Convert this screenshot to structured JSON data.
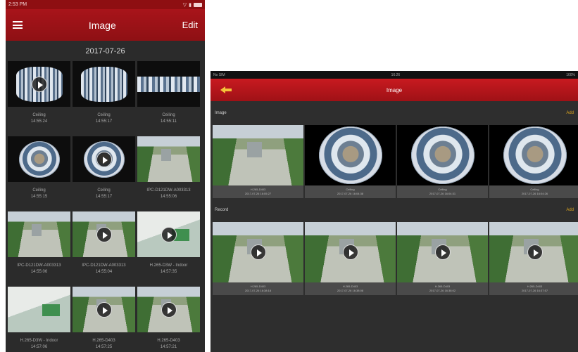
{
  "phone": {
    "status_time": "2:53 PM",
    "title": "Image",
    "edit_label": "Edit",
    "date_header": "2017-07-26",
    "items": [
      {
        "name": "Ceiling",
        "time": "14:55:24",
        "art": "cylinder",
        "video": true
      },
      {
        "name": "Ceiling",
        "time": "14:55:17",
        "art": "cylinder",
        "video": false
      },
      {
        "name": "Ceiling",
        "time": "14:55:11",
        "art": "panorama",
        "video": false
      },
      {
        "name": "Ceiling",
        "time": "14:55:15",
        "art": "fisheye",
        "video": false
      },
      {
        "name": "Ceiling",
        "time": "14:55:17",
        "art": "fisheye",
        "video": true
      },
      {
        "name": "IPC-D121DW-A003313",
        "time": "14:55:06",
        "art": "street",
        "video": false
      },
      {
        "name": "IPC-D121DW-A003313",
        "time": "14:55:06",
        "art": "street",
        "video": false
      },
      {
        "name": "IPC-D121DW-A003313",
        "time": "14:55:04",
        "art": "street",
        "video": true
      },
      {
        "name": "H.265-D3W - Indoor",
        "time": "14:57:35",
        "art": "indoor",
        "video": true
      },
      {
        "name": "H.265-D3W - Indoor",
        "time": "14:57:06",
        "art": "indoor",
        "video": false
      },
      {
        "name": "H.265-D403",
        "time": "14:57:25",
        "art": "street",
        "video": true
      },
      {
        "name": "H.265-D403",
        "time": "14:57:21",
        "art": "street",
        "video": true
      }
    ]
  },
  "tablet": {
    "status_left": "No SIM",
    "status_time": "16:26",
    "status_right": "100%",
    "title": "Image",
    "image_section": {
      "label": "Image",
      "action": "Add"
    },
    "record_section": {
      "label": "Record",
      "action": "Add"
    },
    "images": [
      {
        "name": "H.265-D403",
        "time": "2017-07-26 16:05:27",
        "art": "street"
      },
      {
        "name": "Ceiling",
        "time": "2017-07-26 16:04:38",
        "art": "fisheye"
      },
      {
        "name": "Ceiling",
        "time": "2017-07-26 16:04:31",
        "art": "fisheye"
      },
      {
        "name": "Ceiling",
        "time": "2017-07-26 16:04:26",
        "art": "fisheye"
      }
    ],
    "records": [
      {
        "name": "H.265-D403",
        "time": "2017-07-26 16:38:18",
        "art": "street"
      },
      {
        "name": "H.265-D403",
        "time": "2017-07-26 16:38:08",
        "art": "street"
      },
      {
        "name": "H.265-D403",
        "time": "2017-07-26 16:38:02",
        "art": "street"
      },
      {
        "name": "H.265-D403",
        "time": "2017-07-26 16:37:57",
        "art": "street"
      }
    ]
  }
}
